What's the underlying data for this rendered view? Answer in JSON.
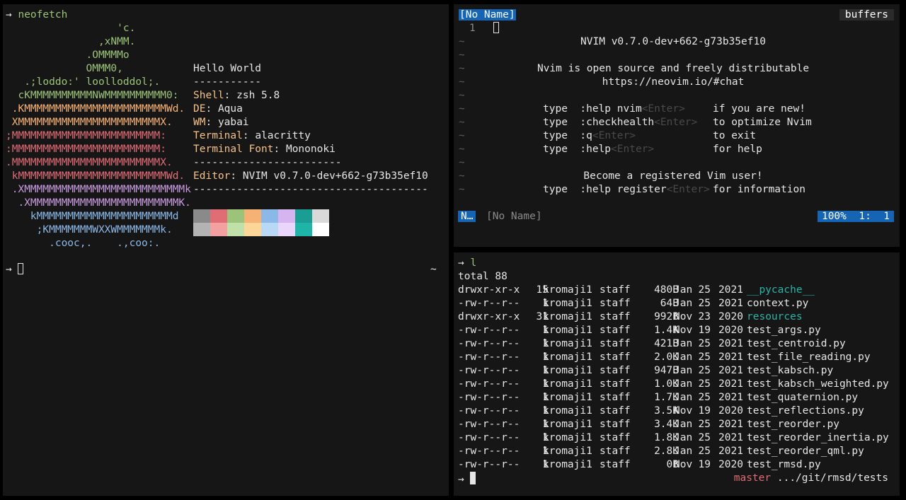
{
  "left": {
    "command": "neofetch",
    "prompt_arrow": "→",
    "logo": [
      {
        "t": "                  'c.",
        "c": "g"
      },
      {
        "t": "               ,xNMM.",
        "c": "g"
      },
      {
        "t": "             .OMMMMo",
        "c": "g"
      },
      {
        "t": "             OMMM0,",
        "c": "g"
      },
      {
        "t": "   .;loddo:' loolloddol;.",
        "c": "g"
      },
      {
        "t": "  cKMMMMMMMMMMNWMMMMMMMMMM0:",
        "c": "g"
      },
      {
        "t": " .KMMMMMMMMMMMMMMMMMMMMMMMWd.",
        "c": "o"
      },
      {
        "t": " XMMMMMMMMMMMMMMMMMMMMMMMX.",
        "c": "o"
      },
      {
        "t": ";MMMMMMMMMMMMMMMMMMMMMMMM:",
        "c": "r"
      },
      {
        "t": ":MMMMMMMMMMMMMMMMMMMMMMMM:",
        "c": "r"
      },
      {
        "t": ".MMMMMMMMMMMMMMMMMMMMMMMMX.",
        "c": "r"
      },
      {
        "t": " kMMMMMMMMMMMMMMMMMMMMMMMMWd.",
        "c": "r"
      },
      {
        "t": " .XMMMMMMMMMMMMMMMMMMMMMMMMMMk",
        "c": "m"
      },
      {
        "t": "  .XMMMMMMMMMMMMMMMMMMMMMMMMK.",
        "c": "m"
      },
      {
        "t": "    kMMMMMMMMMMMMMMMMMMMMMMd",
        "c": "b"
      },
      {
        "t": "     ;KMMMMMMMWXXWMMMMMMMk.",
        "c": "b"
      },
      {
        "t": "       .cooc,.    .,coo:.",
        "c": "b"
      }
    ],
    "info": {
      "title": "Hello World",
      "sep1": "-----------",
      "rows": [
        {
          "label": "Shell",
          "value": "zsh 5.8"
        },
        {
          "label": "DE",
          "value": "Aqua"
        },
        {
          "label": "WM",
          "value": "yabai"
        },
        {
          "label": "Terminal",
          "value": "alacritty"
        },
        {
          "label": "Terminal Font",
          "value": "Mononoki"
        }
      ],
      "sep2": "------------------------",
      "editor_label": "Editor",
      "editor_value": "NVIM v0.7.0-dev+662-g73b35ef10",
      "sep3": "--------------------------------------"
    },
    "palette_top": [
      "#8a8a8a",
      "#e06c75",
      "#9cc37a",
      "#f6b275",
      "#8cb8e8",
      "#d5b4f0",
      "#1a9e94",
      "#d9d9d9"
    ],
    "palette_bottom": [
      "#b3b3b3",
      "#f2a0a0",
      "#bfe0a8",
      "#fcd698",
      "#b9d8f5",
      "#ead6fa",
      "#1eb5a8",
      "#ffffff"
    ],
    "prompt_tilde": "~"
  },
  "vim": {
    "tab_name": "[No Name]",
    "buffers_label": "buffers",
    "line_number": "1",
    "tilde": "~",
    "intro": {
      "version": "NVIM v0.7.0-dev+662-g73b35ef10",
      "line1": "Nvim is open source and freely distributable",
      "line2": "https://neovim.io/#chat",
      "cmds": [
        {
          "type": "type",
          "cmd": ":help nvim",
          "enter": "<Enter>",
          "desc": "if you are new!"
        },
        {
          "type": "type",
          "cmd": ":checkhealth",
          "enter": "<Enter>",
          "desc": "to optimize Nvim"
        },
        {
          "type": "type",
          "cmd": ":q",
          "enter": "<Enter>",
          "desc": "to exit"
        },
        {
          "type": "type",
          "cmd": ":help",
          "enter": "<Enter>",
          "desc": "for help"
        }
      ],
      "register_line": "Become a registered Vim user!",
      "register_cmd": {
        "type": "type",
        "cmd": ":help register",
        "enter": "<Enter>",
        "desc": "for information"
      }
    },
    "status": {
      "mode": "N…",
      "file": "[No Name]",
      "position": "100%  1:  1"
    }
  },
  "ls": {
    "command": "l",
    "prompt_arrow": "→",
    "total": "total 88",
    "rows": [
      {
        "perm": "drwxr-xr-x",
        "links": "15",
        "user": "kromaji1",
        "group": "staff",
        "size": "480B",
        "mon": "Jan",
        "day": "25",
        "year": "2021",
        "name": "__pycache__",
        "dir": true
      },
      {
        "perm": "-rw-r--r--",
        "links": "1",
        "user": "kromaji1",
        "group": "staff",
        "size": "64B",
        "mon": "Jan",
        "day": "25",
        "year": "2021",
        "name": "context.py",
        "dir": false
      },
      {
        "perm": "drwxr-xr-x",
        "links": "31",
        "user": "kromaji1",
        "group": "staff",
        "size": "992B",
        "mon": "Nov",
        "day": "23",
        "year": "2020",
        "name": "resources",
        "dir": true
      },
      {
        "perm": "-rw-r--r--",
        "links": "1",
        "user": "kromaji1",
        "group": "staff",
        "size": "1.4K",
        "mon": "Nov",
        "day": "19",
        "year": "2020",
        "name": "test_args.py",
        "dir": false
      },
      {
        "perm": "-rw-r--r--",
        "links": "1",
        "user": "kromaji1",
        "group": "staff",
        "size": "421B",
        "mon": "Jan",
        "day": "25",
        "year": "2021",
        "name": "test_centroid.py",
        "dir": false
      },
      {
        "perm": "-rw-r--r--",
        "links": "1",
        "user": "kromaji1",
        "group": "staff",
        "size": "2.0K",
        "mon": "Jan",
        "day": "25",
        "year": "2021",
        "name": "test_file_reading.py",
        "dir": false
      },
      {
        "perm": "-rw-r--r--",
        "links": "1",
        "user": "kromaji1",
        "group": "staff",
        "size": "947B",
        "mon": "Jan",
        "day": "25",
        "year": "2021",
        "name": "test_kabsch.py",
        "dir": false
      },
      {
        "perm": "-rw-r--r--",
        "links": "1",
        "user": "kromaji1",
        "group": "staff",
        "size": "1.0K",
        "mon": "Jan",
        "day": "25",
        "year": "2021",
        "name": "test_kabsch_weighted.py",
        "dir": false
      },
      {
        "perm": "-rw-r--r--",
        "links": "1",
        "user": "kromaji1",
        "group": "staff",
        "size": "1.7K",
        "mon": "Jan",
        "day": "25",
        "year": "2021",
        "name": "test_quaternion.py",
        "dir": false
      },
      {
        "perm": "-rw-r--r--",
        "links": "1",
        "user": "kromaji1",
        "group": "staff",
        "size": "3.5K",
        "mon": "Nov",
        "day": "19",
        "year": "2020",
        "name": "test_reflections.py",
        "dir": false
      },
      {
        "perm": "-rw-r--r--",
        "links": "1",
        "user": "kromaji1",
        "group": "staff",
        "size": "3.4K",
        "mon": "Jan",
        "day": "25",
        "year": "2021",
        "name": "test_reorder.py",
        "dir": false
      },
      {
        "perm": "-rw-r--r--",
        "links": "1",
        "user": "kromaji1",
        "group": "staff",
        "size": "1.8K",
        "mon": "Jan",
        "day": "25",
        "year": "2021",
        "name": "test_reorder_inertia.py",
        "dir": false
      },
      {
        "perm": "-rw-r--r--",
        "links": "1",
        "user": "kromaji1",
        "group": "staff",
        "size": "2.8K",
        "mon": "Jan",
        "day": "25",
        "year": "2021",
        "name": "test_reorder_qml.py",
        "dir": false
      },
      {
        "perm": "-rw-r--r--",
        "links": "1",
        "user": "kromaji1",
        "group": "staff",
        "size": "0B",
        "mon": "Nov",
        "day": "19",
        "year": "2020",
        "name": "test_rmsd.py",
        "dir": false
      }
    ],
    "branch": "master",
    "path": ".../git/rmsd/tests"
  }
}
